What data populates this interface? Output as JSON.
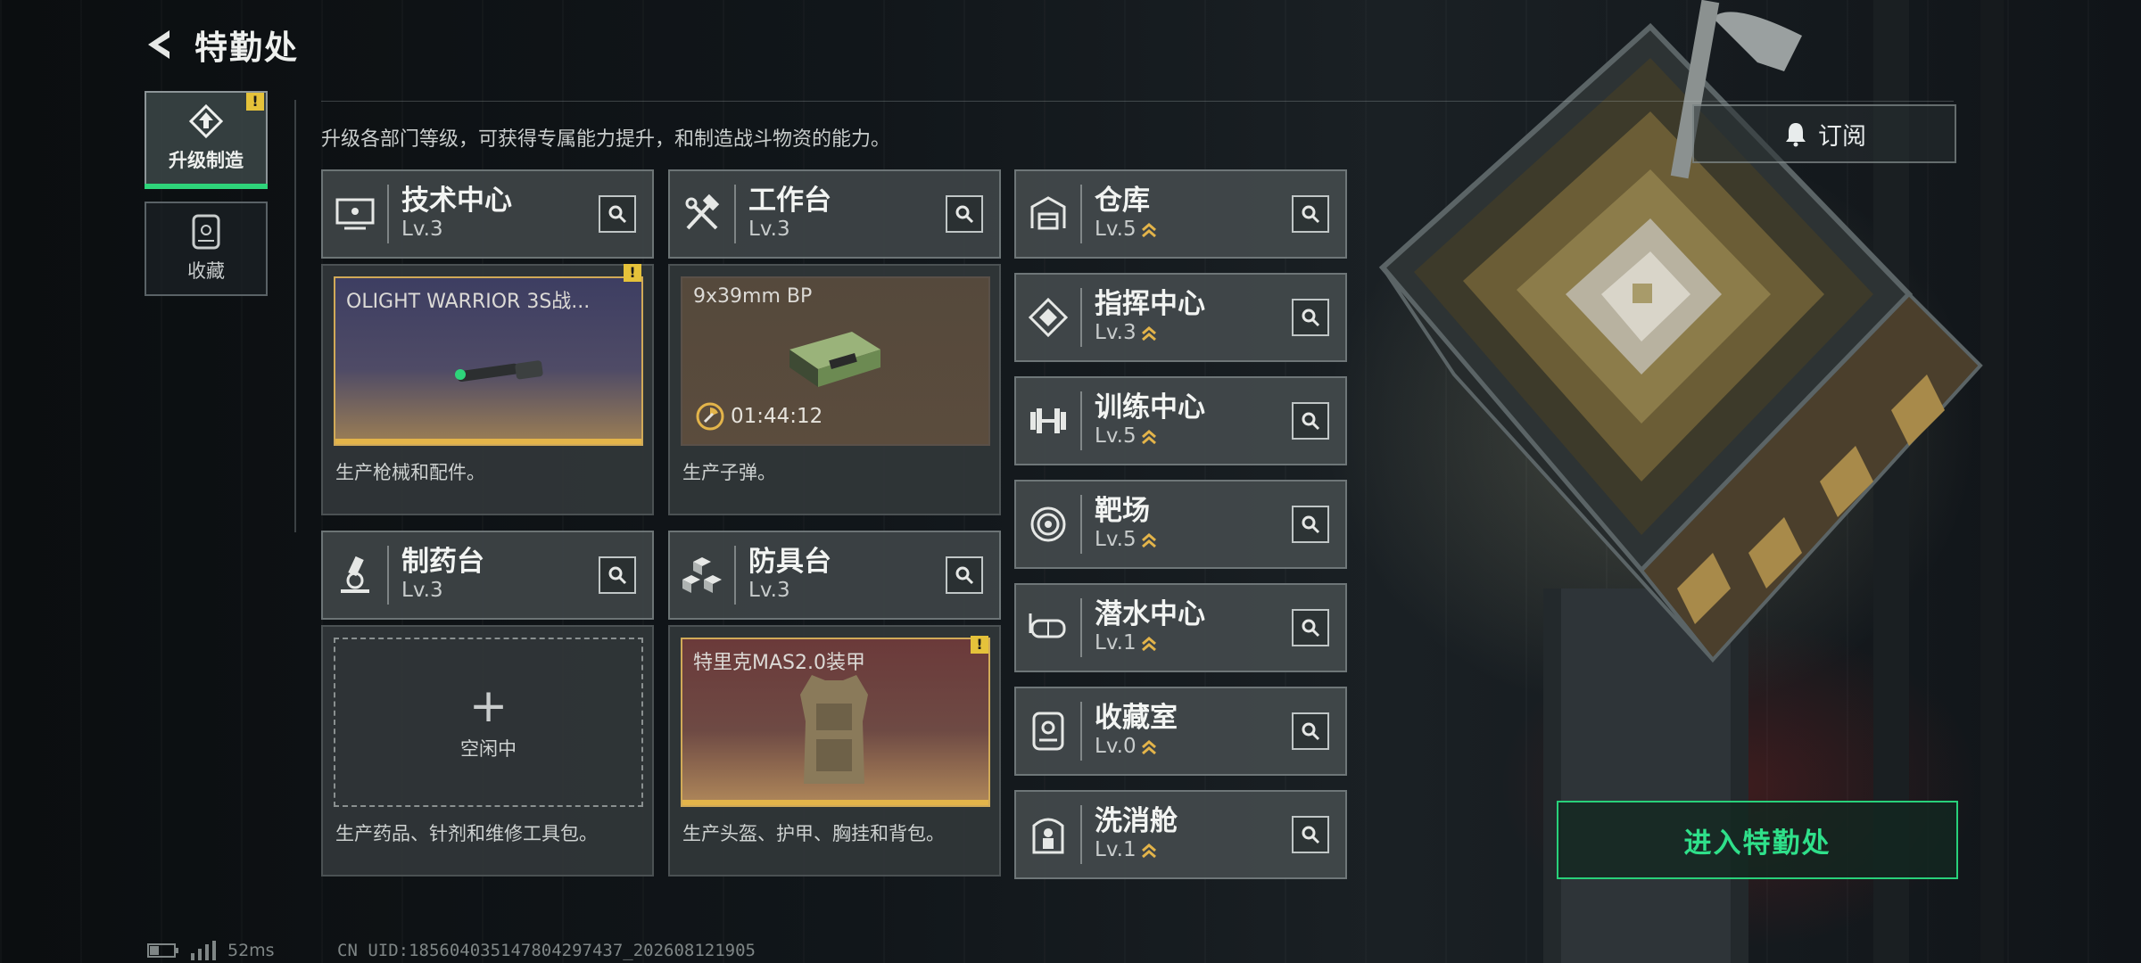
{
  "header": {
    "title": "特勤处"
  },
  "tabs": [
    {
      "label": "升级制造",
      "badge": "!"
    },
    {
      "label": "收藏"
    }
  ],
  "description": "升级各部门等级，可获得专属能力提升，和制造战斗物资的能力。",
  "subscribe_label": "订阅",
  "cards": {
    "tech": {
      "name": "技术中心",
      "level": "Lv.3",
      "item": "OLIGHT WARRIOR 3S战...",
      "badge": "!",
      "desc": "生产枪械和配件。"
    },
    "workbench": {
      "name": "工作台",
      "level": "Lv.3",
      "item": "9x39mm BP",
      "timer": "01:44:12",
      "desc": "生产子弹。"
    },
    "pharmacy": {
      "name": "制药台",
      "level": "Lv.3",
      "idle": "空闲中",
      "plus": "+",
      "desc": "生产药品、针剂和维修工具包。"
    },
    "armor": {
      "name": "防具台",
      "level": "Lv.3",
      "item": "特里克MAS2.0装甲",
      "badge": "!",
      "desc": "生产头盔、护甲、胸挂和背包。"
    }
  },
  "departments": [
    {
      "name": "仓库",
      "level": "Lv.5",
      "icon": "warehouse-icon"
    },
    {
      "name": "指挥中心",
      "level": "Lv.3",
      "icon": "command-icon"
    },
    {
      "name": "训练中心",
      "level": "Lv.5",
      "icon": "dumbbell-icon"
    },
    {
      "name": "靶场",
      "level": "Lv.5",
      "icon": "target-icon"
    },
    {
      "name": "潜水中心",
      "level": "Lv.1",
      "icon": "diving-mask-icon"
    },
    {
      "name": "收藏室",
      "level": "Lv.0",
      "icon": "collection-icon"
    },
    {
      "name": "洗消舱",
      "level": "Lv.1",
      "icon": "decon-icon"
    }
  ],
  "enter_label": "进入特勤处",
  "status": {
    "ping": "52ms",
    "uid": "CN UID:1856040351478042974​37_202608121905"
  },
  "colors": {
    "accent": "#2ed47a",
    "badge": "#e5c23a",
    "rarity_gold": "#e3b44a"
  }
}
